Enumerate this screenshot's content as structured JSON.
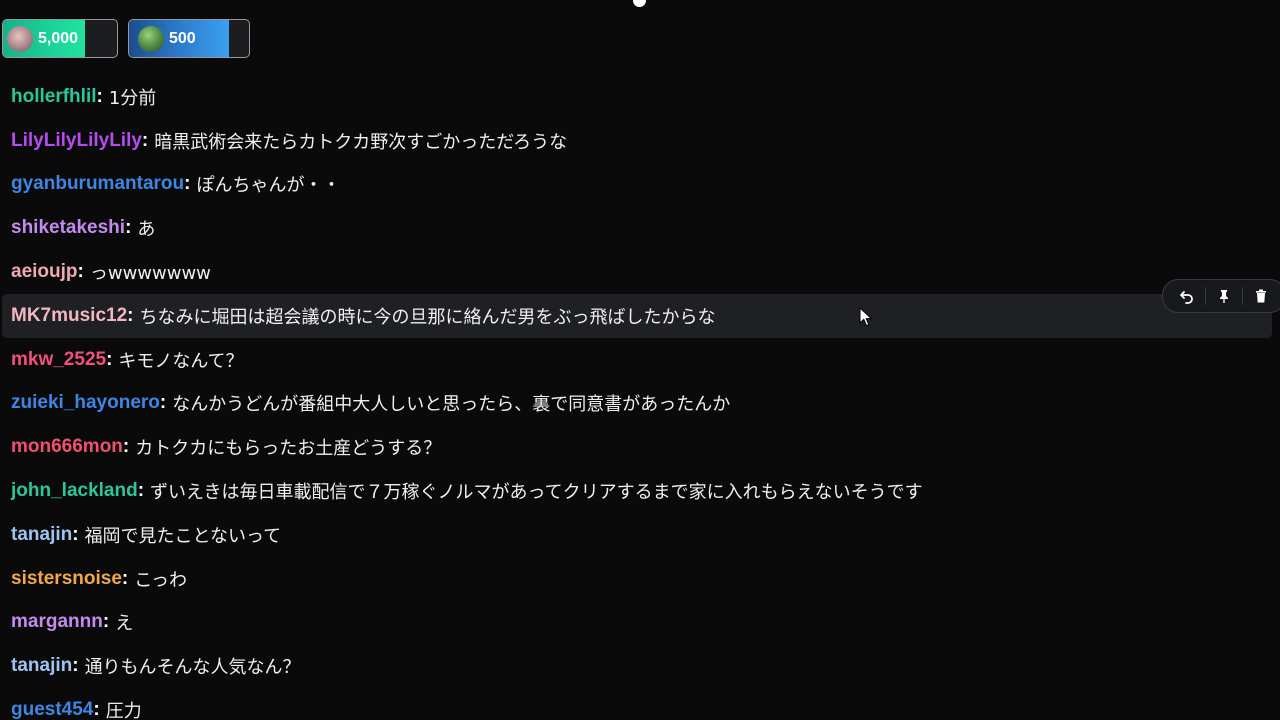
{
  "gifts": [
    {
      "amount": "5,000",
      "fill": 0.72,
      "avatar_icon": "user-avatar-icon"
    },
    {
      "amount": "500",
      "fill": 0.83,
      "avatar_icon": "user-avatar-icon"
    }
  ],
  "messages": [
    {
      "user": "hollerfhlil",
      "color": "#2ac79a",
      "text": "1分前"
    },
    {
      "user": "LilyLilyLilyLily",
      "color": "#b44cf0",
      "text": "暗黒武術会来たらカトクカ野次すごかっただろうな"
    },
    {
      "user": "gyanburumantarou",
      "color": "#3d86e4",
      "text": "ぽんちゃんが・・"
    },
    {
      "user": "shiketakeshi",
      "color": "#c58af0",
      "text": "あ"
    },
    {
      "user": "aeioujp",
      "color": "#f0a8b4",
      "text": "っwwwwwww"
    },
    {
      "user": "MK7music12",
      "color": "#f0b6c2",
      "text": "ちなみに堀田は超会議の時に今の旦那に絡んだ男をぶっ飛ばしたからな"
    },
    {
      "user": "mkw_2525",
      "color": "#f0507a",
      "text": "キモノなんて？"
    },
    {
      "user": "zuieki_hayonero",
      "color": "#3d86e4",
      "text": "なんかうどんが番組中大人しいと思ったら、裏で同意書があったんか"
    },
    {
      "user": "mon666mon",
      "color": "#f0506e",
      "text": "カトクカにもらったお土産どうする？"
    },
    {
      "user": "john_lackland",
      "color": "#2ac79a",
      "text": "ずいえきは毎日車載配信で７万稼ぐノルマがあってクリアするまで家に入れもらえないそうです"
    },
    {
      "user": "tanajin",
      "color": "#9ec3ef",
      "text": "福岡で見たことないって"
    },
    {
      "user": "sistersnoise",
      "color": "#f0a848",
      "text": "こっわ"
    },
    {
      "user": "margannn",
      "color": "#c58af0",
      "text": "え"
    },
    {
      "user": "tanajin",
      "color": "#9ec3ef",
      "text": "通りもんそんな人気なん？"
    },
    {
      "user": "guest454",
      "color": "#3d86e4",
      "text": "圧力"
    }
  ],
  "hovered_message_index": 5,
  "message_actions": [
    {
      "icon": "undo-icon"
    },
    {
      "icon": "pin-icon"
    },
    {
      "icon": "trash-icon"
    }
  ]
}
